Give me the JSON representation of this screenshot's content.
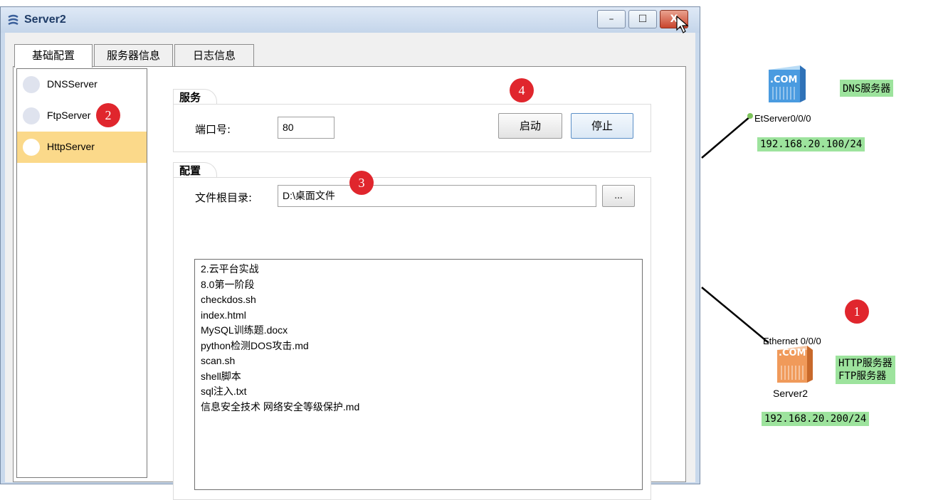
{
  "window": {
    "title": "Server2",
    "controls": {
      "minimize": "–",
      "maximize": "☐",
      "close": "X"
    }
  },
  "tabs": [
    "基础配置",
    "服务器信息",
    "日志信息"
  ],
  "services": [
    "DNSServer",
    "FtpServer",
    "HttpServer"
  ],
  "selected_service": "HttpServer",
  "service_group": {
    "title": "服务",
    "port_label": "端口号:",
    "port_value": "80",
    "start_label": "启动",
    "stop_label": "停止"
  },
  "config_group": {
    "title": "配置",
    "root_label": "文件根目录:",
    "root_value": "D:\\桌面文件",
    "browse_label": "..."
  },
  "files": [
    "2.云平台实战",
    "8.0第一阶段",
    "checkdos.sh",
    "index.html",
    "MySQL训练题.docx",
    "python检测DOS攻击.md",
    "scan.sh",
    "shell脚本",
    "sql注入.txt",
    "信息安全技术 网络安全等级保护.md"
  ],
  "markers": [
    "1",
    "2",
    "3",
    "4"
  ],
  "topology": {
    "dns_server": {
      "icon_text": ".COM",
      "overlap_label": "EtServer0/0/0",
      "role": "DNS服务器",
      "ip": "192.168.20.100/24"
    },
    "http_server": {
      "icon_text": ".COM",
      "port_label": "Ethernet 0/0/0",
      "name": "Server2",
      "roles": [
        "HTTP服务器",
        "FTP服务器"
      ],
      "ip": "192.168.20.200/24"
    }
  },
  "colors": {
    "selected_row": "#fbd98a",
    "marker": "#e0262d",
    "role_label_bg": "#9de39d",
    "link": "#000000"
  }
}
